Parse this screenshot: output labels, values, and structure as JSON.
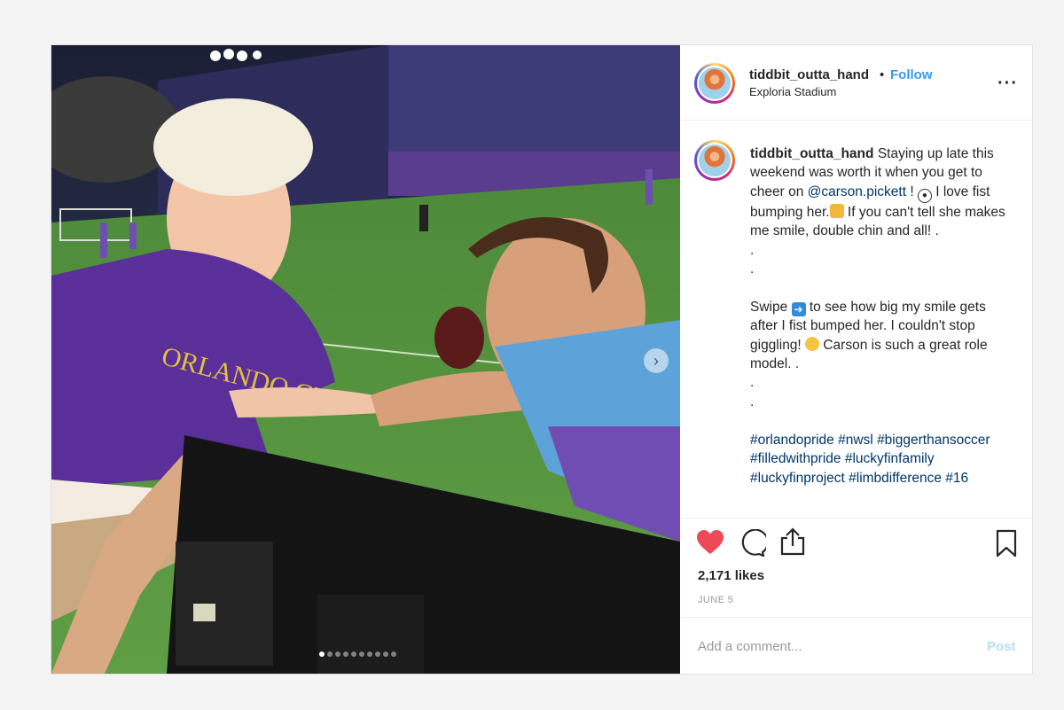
{
  "post": {
    "header": {
      "username": "tiddbit_outta_hand",
      "separator": "•",
      "follow_label": "Follow",
      "location": "Exploria Stadium",
      "more_icon": "more-options-icon"
    },
    "photo": {
      "carousel_dots": 10,
      "active_dot": 0,
      "next_icon": "chevron-right-icon"
    },
    "caption": {
      "username": "tiddbit_outta_hand",
      "line1": "Staying up late this weekend was worth it when you get to cheer on ",
      "mention": "@carson.pickett",
      "line2": " ! ",
      "line3": " I love fist bumping her.",
      "line4": " If you can't tell she makes me smile, double chin and all! .",
      "dot": ".",
      "swipe1": "Swipe ",
      "swipe2": " to see how big my smile gets after I fist bumped her. I couldn't stop giggling! ",
      "swipe3": " Carson is such a great role model. .",
      "hashtags": [
        "#orlandopride",
        "#nwsl",
        "#biggerthansoccer",
        "#filledwithpride",
        "#luckyfinfamily",
        "#luckyfinproject",
        "#limbdifference",
        "#16"
      ]
    },
    "actions": {
      "like_icon": "heart-icon",
      "comment_icon": "comment-icon",
      "share_icon": "share-icon",
      "save_icon": "bookmark-icon",
      "likes_text": "2,171 likes",
      "date": "JUNE 5"
    },
    "add_comment": {
      "placeholder": "Add a comment...",
      "post_label": "Post"
    },
    "colors": {
      "like_red": "#ed4956",
      "link_blue": "#3897f0",
      "hashtag_blue": "#003569"
    }
  }
}
